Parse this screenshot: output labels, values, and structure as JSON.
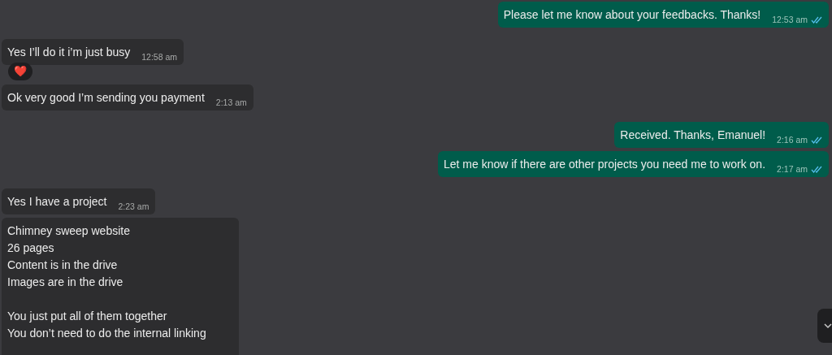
{
  "messages": [
    {
      "kind": "outgoing",
      "paragraphs": [
        [
          "Please let me know about your feedbacks. Thanks!"
        ]
      ],
      "time": "12:53 am",
      "read": true
    },
    {
      "kind": "incoming",
      "paragraphs": [
        [
          "Yes I’ll do it i’m just busy"
        ]
      ],
      "time": "12:58 am",
      "reaction": "❤️"
    },
    {
      "kind": "incoming",
      "paragraphs": [
        [
          "Ok very good I’m sending you payment"
        ]
      ],
      "time": "2:13 am"
    },
    {
      "kind": "outgoing",
      "paragraphs": [
        [
          "Received. Thanks, Emanuel!"
        ]
      ],
      "time": "2:16 am",
      "read": true
    },
    {
      "kind": "outgoing",
      "paragraphs": [
        [
          "Let me know if there are other projects you need me to work on."
        ]
      ],
      "time": "2:17 am",
      "read": true
    },
    {
      "kind": "incoming",
      "paragraphs": [
        [
          "Yes I have a project"
        ]
      ],
      "time": "2:23 am"
    },
    {
      "kind": "incoming",
      "paragraphs": [
        [
          "Chimney sweep website",
          "26 pages",
          "Content is in the drive",
          "Images are in the drive"
        ],
        [
          "You just put all of them together",
          "You don’t need to do the internal linking"
        ]
      ]
    }
  ]
}
